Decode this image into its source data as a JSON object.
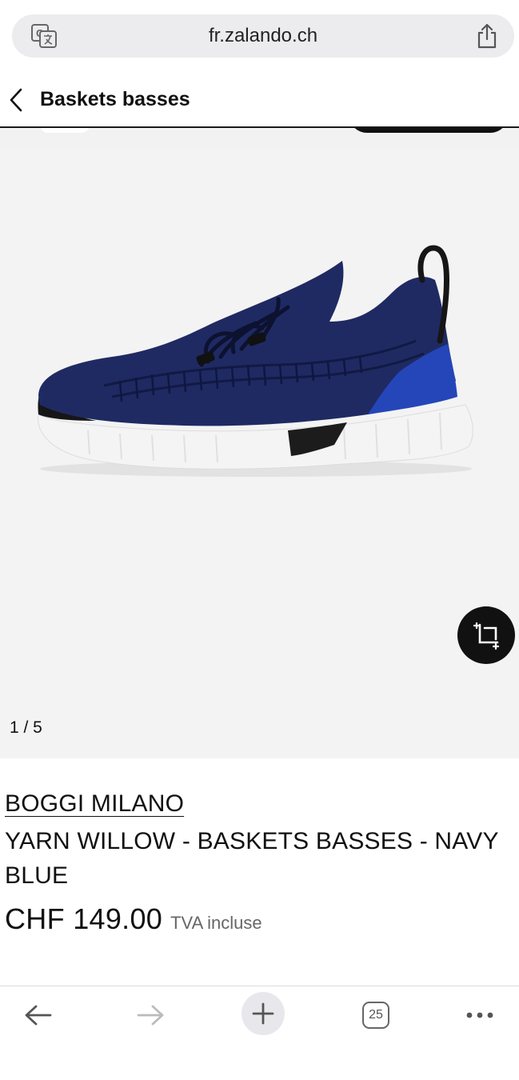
{
  "browser": {
    "url": "fr.zalando.ch",
    "tab_count": "25"
  },
  "header": {
    "title": "Baskets basses"
  },
  "gallery": {
    "counter": "1 / 5"
  },
  "product": {
    "brand": "BOGGI MILANO",
    "name": "YARN WILLOW - BASKETS BASSES - NAVY BLUE",
    "price": "CHF 149.00",
    "vat_note": "TVA incluse"
  },
  "icons": {
    "translate": "translate-icon",
    "share": "share-icon",
    "back": "chevron-left-icon",
    "ar": "ar-view-icon",
    "nav_back": "arrow-left-icon",
    "nav_forward": "arrow-right-icon",
    "new_tab": "plus-icon",
    "tabs": "tabs-icon",
    "more": "more-icon"
  },
  "colors": {
    "shoe_upper": "#1f2a63",
    "shoe_accent": "#2446b8",
    "sole": "#f4f4f4",
    "gallery_bg": "#f3f3f3"
  }
}
